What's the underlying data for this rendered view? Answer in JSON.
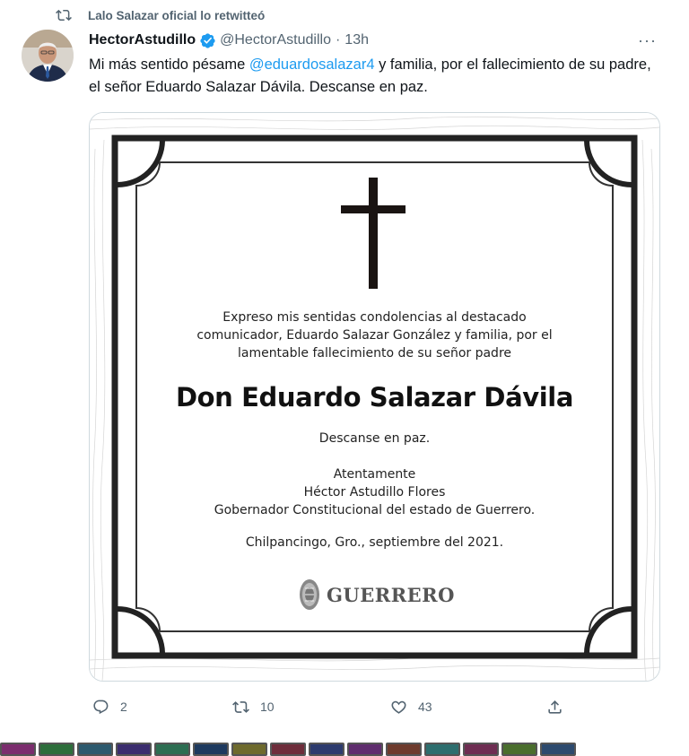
{
  "retweet": {
    "text": "Lalo Salazar oficial lo retwitteó",
    "icon": "retweet-icon"
  },
  "tweet": {
    "author": {
      "display_name": "HectorAstudillo",
      "handle": "@HectorAstudillo",
      "verified": true,
      "time": "13h"
    },
    "text_before": "Mi más sentido pésame ",
    "mention": "@eduardosalazar4",
    "text_after": " y familia, por el fallecimiento de su padre, el señor Eduardo Salazar Dávila. Descanse en paz.",
    "more_label": "···"
  },
  "card": {
    "condolence_lines": [
      "Expreso mis sentidas condolencias al destacado",
      "comunicador, Eduardo Salazar González y familia, por el",
      "lamentable fallecimiento de su señor padre"
    ],
    "name": "Don Eduardo Salazar Dávila",
    "descanse": "Descanse en paz.",
    "signature_lines": [
      "Atentamente",
      "Héctor Astudillo Flores",
      "Gobernador Constitucional del estado de Guerrero."
    ],
    "place_date": "Chilpancingo, Gro., septiembre del 2021.",
    "logo_text": "GUERRERO"
  },
  "actions": {
    "replies": "2",
    "retweets": "10",
    "likes": "43"
  },
  "colors": {
    "accent": "#1d9bf0",
    "muted": "#536471",
    "verified": "#1d9bf0"
  },
  "palette_colors": [
    "#7b2d6e",
    "#2d6e3b",
    "#2d5a6e",
    "#3b2d6e",
    "#2d6e52",
    "#1e3a5f",
    "#6e6a2d",
    "#6e2d3b",
    "#2d3b6e",
    "#5f2d6e",
    "#6e3b2d",
    "#2d6e6e",
    "#6e2d52",
    "#4a6e2d",
    "#2d4a6e"
  ]
}
